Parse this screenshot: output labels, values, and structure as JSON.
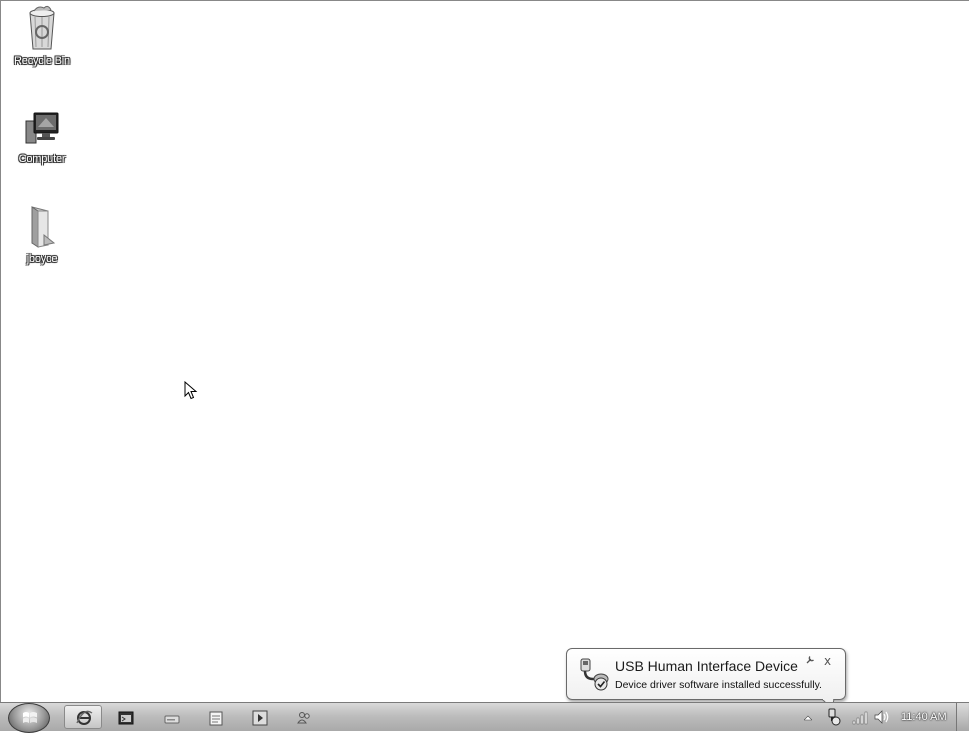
{
  "desktop": {
    "icons": [
      {
        "label": "Recycle Bin",
        "icon": "recycle-bin-icon"
      },
      {
        "label": "Computer",
        "icon": "computer-icon"
      },
      {
        "label": "jboyce",
        "icon": "user-folder-icon"
      }
    ]
  },
  "notification": {
    "title": "USB Human Interface Device",
    "message": "Device driver software installed successfully.",
    "icon": "usb-device-icon",
    "options_icon": "wrench-icon",
    "close_glyph": "x"
  },
  "taskbar": {
    "start_icon": "windows-orb-icon",
    "pinned": [
      "internet-explorer-icon",
      "console-icon",
      "drive-icon",
      "notepad-icon",
      "media-player-icon",
      "users-icon"
    ],
    "tray": {
      "icons": [
        "show-hidden-icons-arrow",
        "device-installing-icon",
        "network-icon",
        "volume-icon"
      ],
      "clock": "11:40 AM"
    }
  }
}
